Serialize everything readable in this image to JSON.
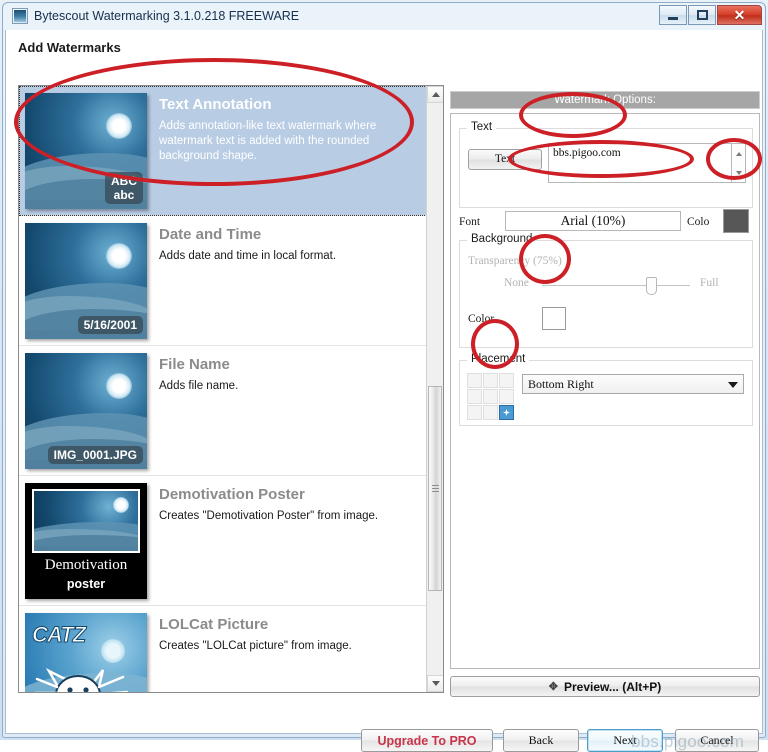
{
  "window": {
    "title": "Bytescout Watermarking 3.1.0.218 FREEWARE",
    "minimize_label": "–",
    "maximize_label": "□",
    "close_label": "✕"
  },
  "page": {
    "heading": "Add Watermarks"
  },
  "watermark_list": {
    "items": [
      {
        "title": "Text Annotation",
        "description": "Adds annotation-like text watermark where watermark text is added with the rounded background shape.",
        "badge_line1": "ABC",
        "badge_line2": "abc",
        "selected": true,
        "thumb_style": "photo"
      },
      {
        "title": "Date and Time",
        "description": "Adds date and time in local format.",
        "badge_line1": "5/16/2001",
        "badge_line2": "",
        "selected": false,
        "thumb_style": "photo"
      },
      {
        "title": "File Name",
        "description": "Adds file name.",
        "badge_line1": "IMG_0001.JPG",
        "badge_line2": "",
        "selected": false,
        "thumb_style": "photo"
      },
      {
        "title": "Demotivation Poster",
        "description": "Creates \"Demotivation Poster\" from image.",
        "poster_line1": "Demotivation",
        "poster_line2": "poster",
        "selected": false,
        "thumb_style": "poster"
      },
      {
        "title": "LOLCat Picture",
        "description": "Creates \"LOLCat picture\" from image.",
        "catz_word": "CATZ",
        "selected": false,
        "thumb_style": "catz"
      }
    ]
  },
  "options": {
    "header": "Watermark Options:",
    "text_group": {
      "label": "Text",
      "button_label": "Text",
      "input_value": "bbs.pigoo.com",
      "input_placeholder": ""
    },
    "font_row": {
      "label": "Font",
      "value": "Arial (10%)",
      "color_label": "Colo",
      "color_swatch": "#575757"
    },
    "background_group": {
      "label": "Background",
      "transparency_label": "Transparency (75%)",
      "slider_min_label": "None",
      "slider_max_label": "Full",
      "slider_percent": 75,
      "color_label": "Color",
      "color_swatch": "#ffffff",
      "disabled": true
    },
    "placement_group": {
      "label": "Placement",
      "selected_position": "Bottom Right",
      "grid_active_index": 8,
      "grid_cells": 9
    },
    "preview_button": {
      "label_pre": "",
      "label_u": "P",
      "label_full": "Preview... (Alt+P)",
      "icon": "move-icon"
    }
  },
  "footer": {
    "upgrade_label": "Upgrade To PRO",
    "back_label": "Back",
    "back_accel": "B",
    "next_label": "Next",
    "next_accel": "N",
    "cancel_label": "Cancel",
    "cancel_accel": "C"
  },
  "overlay": {
    "watermark_text": "bbs.pigoo.com"
  },
  "annotations": {
    "accent_color": "#cc2026",
    "count": 6
  }
}
